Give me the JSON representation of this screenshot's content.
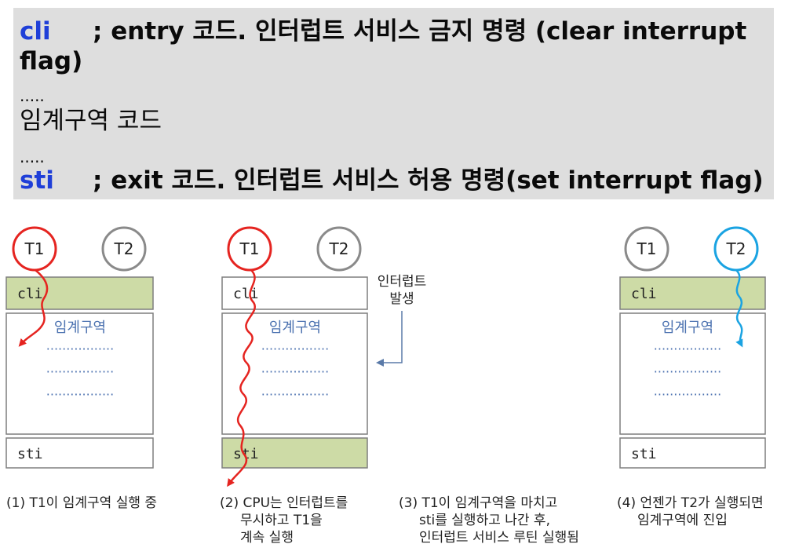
{
  "code": {
    "line1": {
      "keyword": "cli",
      "text": "; entry 코드. 인터럽트 서비스 금지 명령 (clear interrupt"
    },
    "line1_cont": "flag)",
    "dots1": ".....",
    "critical": "임계구역 코드",
    "dots2": ".....",
    "line2": {
      "keyword": "sti",
      "text": "; exit 코드. 인터럽트 서비스 허용 명령(set interrupt flag)"
    }
  },
  "diagram": {
    "thread1": "T1",
    "thread2": "T2",
    "cli_label": "cli",
    "critical_label": "임계구역",
    "sti_label": "sti",
    "dotted": "·················",
    "interrupt_label": [
      "인터럽트",
      "발생"
    ]
  },
  "captions": {
    "c1": [
      "(1) T1이 임계구역 실행 중"
    ],
    "c2": [
      "(2) CPU는 인터럽트를",
      "무시하고 T1을",
      "계속 실행"
    ],
    "c3": [
      "(3) T1이 임계구역을 마치고",
      "sti를 실행하고 나간 후,",
      "인터럽트 서비스 루틴 실행됨"
    ],
    "c4": [
      "(4) 언젠가 T2가 실행되면",
      "임계구역에 진입"
    ]
  },
  "colors": {
    "red": "#e52420",
    "blue": "#1aa3e2",
    "gray": "#8a8a8a",
    "green": "#cddba6",
    "section_text": "#4c72b0"
  }
}
